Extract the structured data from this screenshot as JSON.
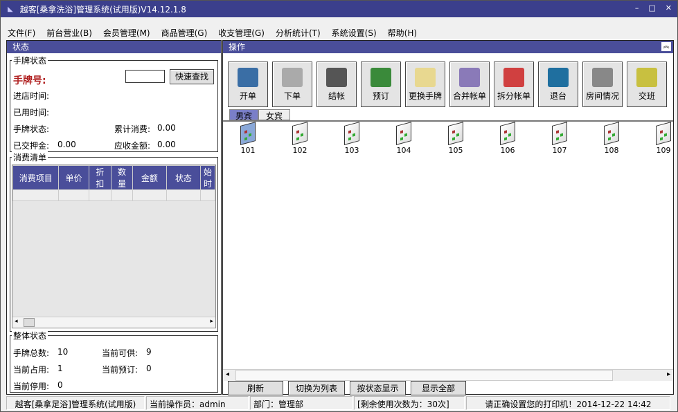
{
  "title": "越客[桑拿洗浴]管理系统(试用版)V14.12.1.8",
  "window_controls": [
    "–",
    "□",
    "✕"
  ],
  "menu": [
    "文件(F)",
    "前台营业(B)",
    "会员管理(M)",
    "商品管理(G)",
    "收支管理(G)",
    "分析统计(T)",
    "系统设置(S)",
    "帮助(H)"
  ],
  "left": {
    "header": "状态",
    "card": {
      "legend": "手牌状态",
      "card_no_label": "手牌号:",
      "search_value": "",
      "search_button": "快速查找",
      "enter_time": "进店时间:",
      "used_time": "已用时间:",
      "card_status": "手牌状态:",
      "total_label": "累计消费:",
      "total_value": "0.00",
      "deposit_label": "已交押金:",
      "deposit_value": "0.00",
      "receivable_label": "应收金额:",
      "receivable_value": "0.00"
    },
    "consume": {
      "legend": "消费清单",
      "columns": [
        "消费项目",
        "单价",
        "折扣",
        "数量",
        "金额",
        "状态",
        "始时"
      ]
    },
    "overall": {
      "legend": "整体状态",
      "total_label": "手牌总数:",
      "total": "10",
      "avail_label": "当前可供:",
      "avail": "9",
      "occupied_label": "当前占用:",
      "occupied": "1",
      "reserved_label": "当前预订:",
      "reserved": "0",
      "disabled_label": "当前停用:",
      "disabled": "0"
    }
  },
  "right": {
    "header": "操作",
    "collapse_icon": "︽",
    "toolbar": [
      {
        "label": "开单",
        "color": "#3a6ea5"
      },
      {
        "label": "下单",
        "color": "#aaa"
      },
      {
        "label": "结帐",
        "color": "#555"
      },
      {
        "label": "预订",
        "color": "#3a8a3a"
      },
      {
        "label": "更换手牌",
        "color": "#e8d890"
      },
      {
        "label": "合并帐单",
        "color": "#8a7ab8"
      },
      {
        "label": "拆分帐单",
        "color": "#d04040"
      },
      {
        "label": "退台",
        "color": "#1f6f9f"
      },
      {
        "label": "房间情况",
        "color": "#888"
      },
      {
        "label": "交班",
        "color": "#c8c040"
      }
    ],
    "tabs": [
      "男宾",
      "女宾"
    ],
    "rooms": [
      "101",
      "102",
      "103",
      "104",
      "105",
      "106",
      "107",
      "108",
      "109"
    ],
    "bottom_buttons": [
      "刷新",
      "切换为列表",
      "按状态显示",
      "显示全部"
    ]
  },
  "statusbar": [
    "越客[桑拿足浴]管理系统(试用版)",
    "当前操作员：admin",
    "部门：管理部",
    "[剩余使用次数为：30次]",
    "请正确设置您的打印机！2014-12-22 14:42"
  ]
}
